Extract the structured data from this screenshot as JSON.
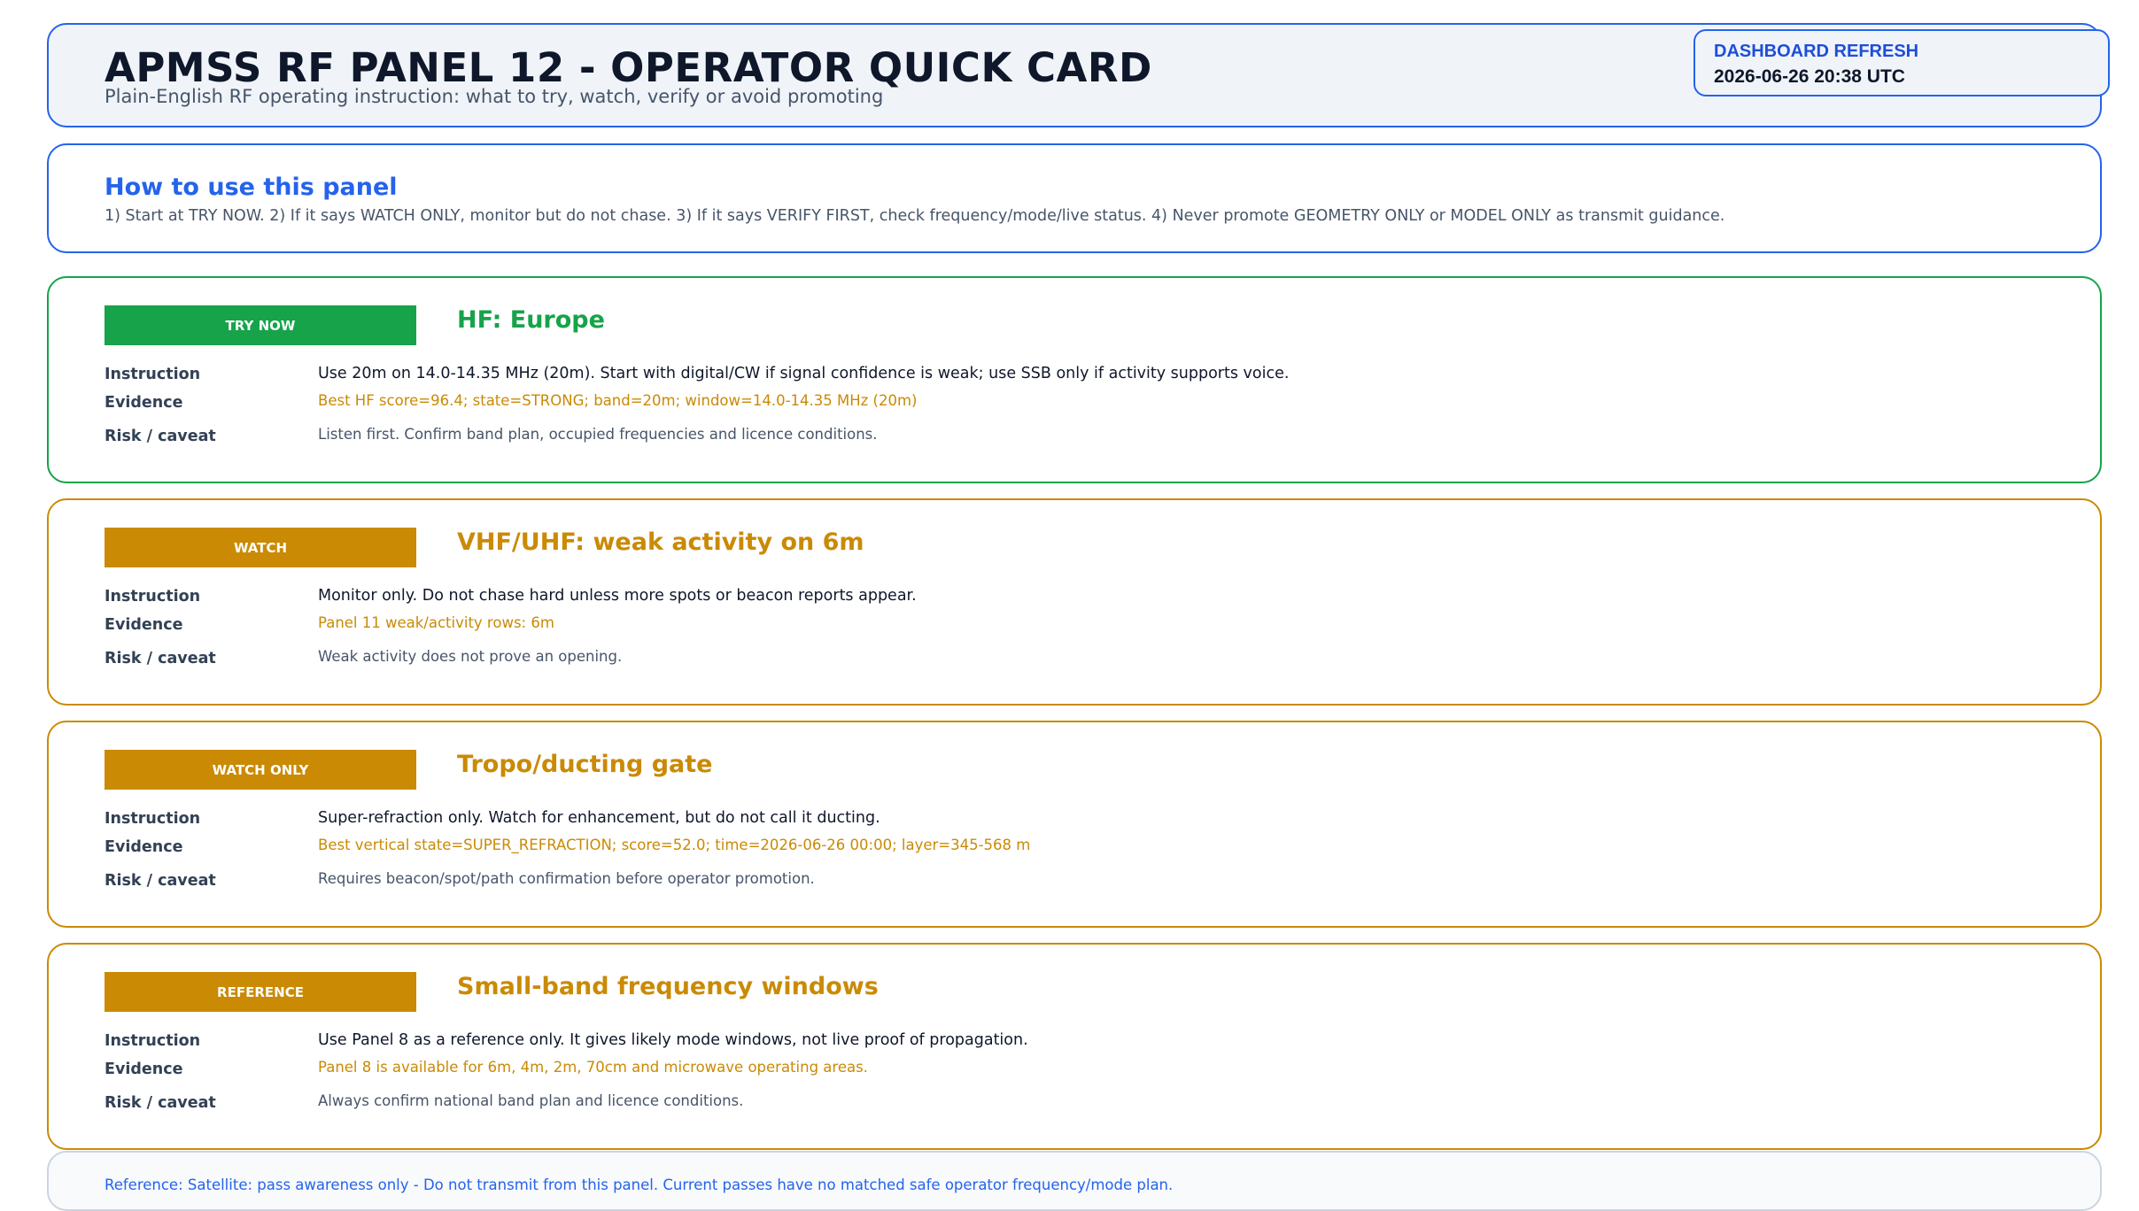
{
  "header": {
    "title": "APMSS RF PANEL 12 - OPERATOR QUICK CARD",
    "subtitle": "Plain-English RF operating instruction: what to try, watch, verify or avoid promoting"
  },
  "refresh": {
    "label": "DASHBOARD REFRESH",
    "timestamp": "2026-06-26 20:38 UTC"
  },
  "howto": {
    "heading": "How to use this panel",
    "text": "1) Start at TRY NOW.  2) If it says WATCH ONLY, monitor but do not chase.  3) If it says VERIFY FIRST, check frequency/mode/live status.  4) Never promote GEOMETRY ONLY or MODEL ONLY as transmit guidance."
  },
  "labels": {
    "instruction": "Instruction",
    "evidence": "Evidence",
    "risk": "Risk / caveat"
  },
  "colors": {
    "accent": "#2563eb",
    "try_now": "#16a34a",
    "watch": "#ca8a04"
  },
  "items": [
    {
      "badge": "TRY NOW",
      "heading": "HF: Europe",
      "instruction": "Use 20m on 14.0-14.35 MHz (20m). Start with digital/CW if signal confidence is weak; use SSB only if activity supports voice.",
      "evidence": "Best HF score=96.4; state=STRONG; band=20m; window=14.0-14.35 MHz (20m)",
      "risk": "Listen first. Confirm band plan, occupied frequencies and licence conditions."
    },
    {
      "badge": "WATCH",
      "heading": "VHF/UHF: weak activity on 6m",
      "instruction": "Monitor only. Do not chase hard unless more spots or beacon reports appear.",
      "evidence": "Panel 11 weak/activity rows: 6m",
      "risk": "Weak activity does not prove an opening."
    },
    {
      "badge": "WATCH ONLY",
      "heading": "Tropo/ducting gate",
      "instruction": "Super-refraction only. Watch for enhancement, but do not call it ducting.",
      "evidence": "Best vertical state=SUPER_REFRACTION; score=52.0; time=2026-06-26 00:00; layer=345-568 m",
      "risk": "Requires beacon/spot/path confirmation before operator promotion."
    },
    {
      "badge": "REFERENCE",
      "heading": "Small-band frequency windows",
      "instruction": "Use Panel 8 as a reference only. It gives likely mode windows, not live proof of propagation.",
      "evidence": "Panel 8 is available for 6m, 4m, 2m, 70cm and microwave operating areas.",
      "risk": "Always confirm national band plan and licence conditions."
    }
  ],
  "footer": {
    "text": "Reference: Satellite: pass awareness only - Do not transmit from this panel. Current passes have no matched safe operator frequency/mode plan."
  }
}
